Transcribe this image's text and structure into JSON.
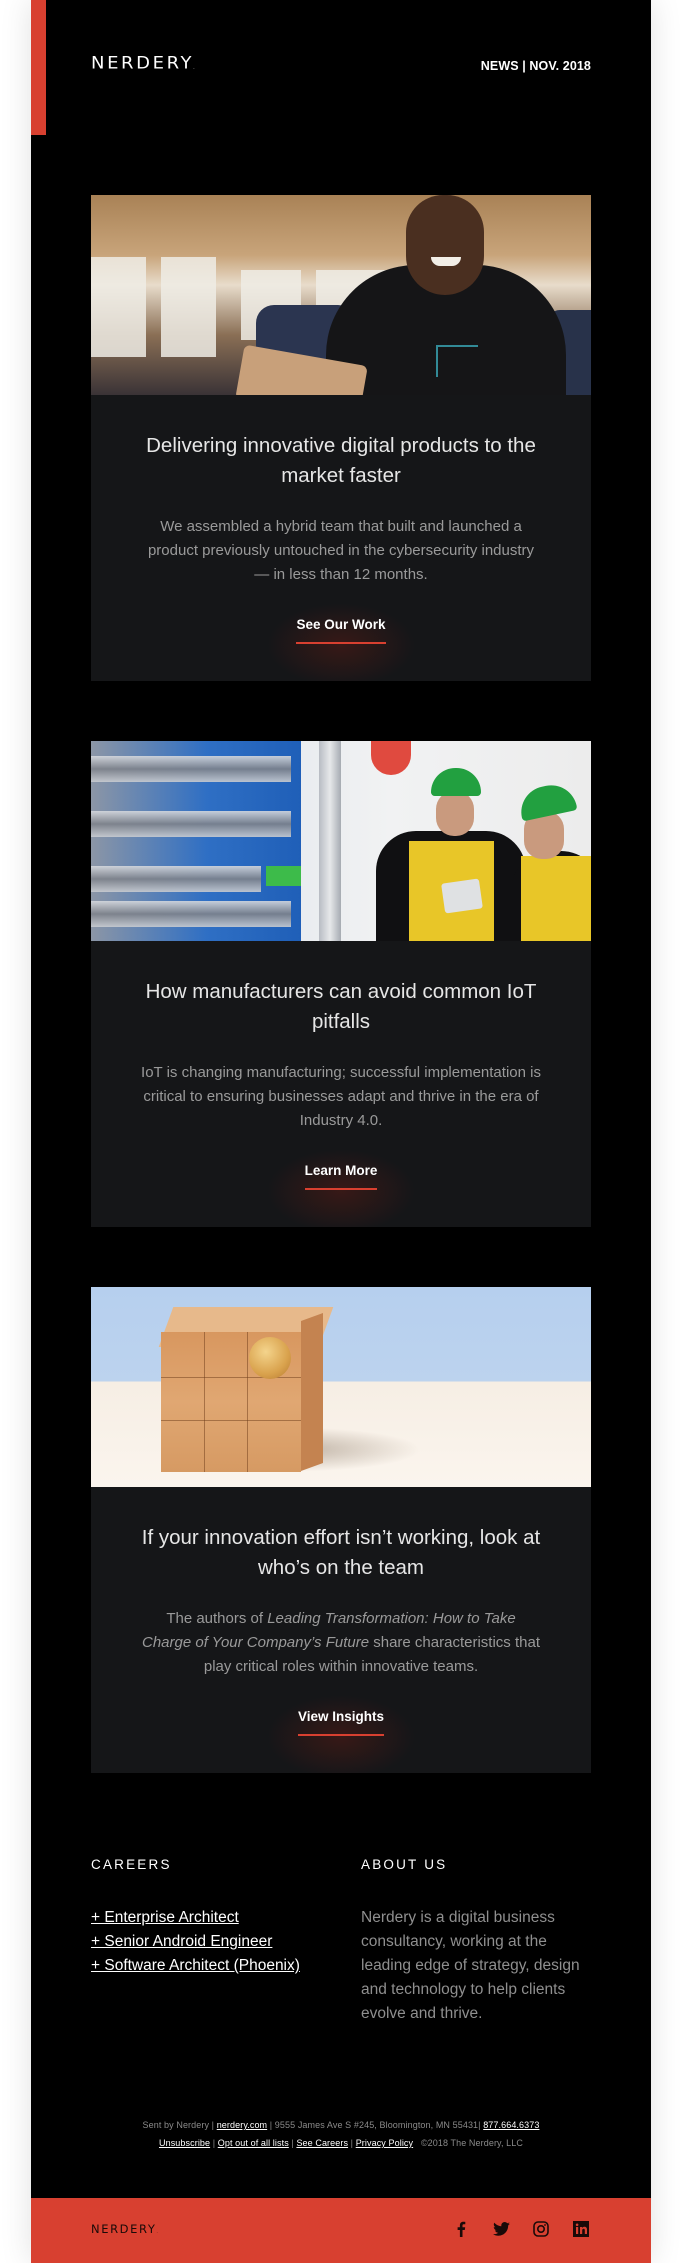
{
  "header": {
    "logo": "NERDERY",
    "logo_dot": ".",
    "issue_label": "NEWS | NOV. 2018"
  },
  "colors": {
    "brand_red": "#d84030",
    "background": "#000000",
    "card": "#151618"
  },
  "cards": [
    {
      "image_alt": "Smiling man using a tablet in an office",
      "title": "Delivering innovative digital products to the market faster",
      "body": "We assembled a hybrid team that built and launched a product previously untouched in the cybersecurity industry — in less than 12 months.",
      "cta": "See Our Work"
    },
    {
      "image_alt": "Two factory workers in hard hats reviewing a tablet",
      "title": "How manufacturers can avoid common IoT pitfalls",
      "body": "IoT is changing manufacturing; successful implementation is critical to ensuring businesses adapt and thrive in the era of Industry 4.0.",
      "cta": "Learn More"
    },
    {
      "image_alt": "Wooden block cube with a wooden ball",
      "title": "If your innovation effort isn’t working, look at who’s on the team",
      "body_prefix": "The authors of ",
      "body_italic": "Leading Transformation: How to Take Charge of Your Company’s Future",
      "body_suffix": " share characteristics that play critical roles within innovative teams.",
      "cta": "View Insights"
    }
  ],
  "careers": {
    "title": "CAREERS",
    "jobs": [
      "+ Enterprise Architect",
      "+ Senior Android Engineer",
      "+ Software Architect (Phoenix)"
    ]
  },
  "about": {
    "title": "ABOUT US",
    "text": "Nerdery is a digital business consultancy, working at the leading edge of strategy, design and technology to help clients evolve and thrive."
  },
  "legal": {
    "sent_by": "Sent by Nerdery | ",
    "website": "nerdery.com",
    "address": " | 9555 James Ave S #245, Bloomington, MN 55431| ",
    "phone": "877.664.6373",
    "links": [
      "Unsubscribe",
      "Opt out of all lists",
      "See Careers",
      "Privacy Policy"
    ],
    "separator": " | ",
    "copyright": "©2018 The Nerdery, LLC"
  },
  "footer": {
    "logo": "NERDERY",
    "logo_dot": ".",
    "social": [
      {
        "name": "facebook-icon"
      },
      {
        "name": "twitter-icon"
      },
      {
        "name": "instagram-icon"
      },
      {
        "name": "linkedin-icon"
      }
    ]
  }
}
